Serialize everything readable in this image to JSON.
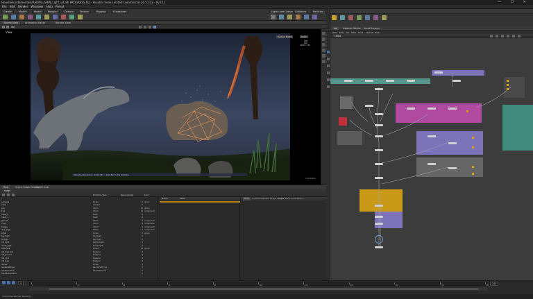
{
  "window": {
    "title": "HoudiniFundamentals/ASUMG_SHIN_Light_v4_86 PROGRESS.hip - Houdini Indie Limited Commercial 20.5.332 - Py3.11",
    "center_label": "Build",
    "controls": "— ☐ ✕"
  },
  "menubar": [
    "File",
    "Edit",
    "Render",
    "Windows",
    "Help",
    "Preset"
  ],
  "shelf": {
    "tabs": [
      "Create",
      "Modify",
      "Model",
      "Polygon",
      "Deform",
      "Texture",
      "Rigging",
      "Characters"
    ],
    "right_tabs": [
      "Lights and Cameras",
      "Collisions",
      "Particles"
    ],
    "tool_colors": [
      "#7a9a5a",
      "#5a7aa0",
      "#a07a4a",
      "#8a5a8a",
      "#5a9a9a",
      "#9a9a5a",
      "#6a6aa0",
      "#a05a5a",
      "#5aa07a",
      "#a0a05a",
      "#7a7a7a",
      "#5a8aa0"
    ]
  },
  "left_pane": {
    "tabs": [
      "Scene View",
      "Animation Editor",
      "Render View"
    ],
    "path": "obj",
    "viewport_label": "View",
    "camera_label": "Medium Detail",
    "persp_label": "cam1",
    "stats": [
      "1/61",
      "102",
      "1280 x 720"
    ],
    "status_text": "Interactive Rendering ... Karma XPU ... press Esc to stop rendering",
    "corner_label": "Indie Edition"
  },
  "spreadsheet": {
    "tabs": [
      "Tree",
      "Scene Graph Details",
      "Light Linker"
    ],
    "path": "stage",
    "columns": [
      "Primitive Type",
      "Descendants",
      "Kind"
    ],
    "rows": [
      {
        "name": "/",
        "type": "",
        "desc": "",
        "kind": ""
      },
      {
        "name": "  cameras",
        "type": "Scope",
        "desc": "2",
        "kind": "group"
      },
      {
        "name": "    cam1",
        "type": "Camera",
        "desc": "0",
        "kind": ""
      },
      {
        "name": "  geo",
        "type": "Xform",
        "desc": "41",
        "kind": "group"
      },
      {
        "name": "    trex",
        "type": "Xform",
        "desc": "12",
        "kind": "component"
      },
      {
        "name": "      mesh_0",
        "type": "Mesh",
        "desc": "0",
        "kind": ""
      },
      {
        "name": "      mesh_1",
        "type": "Mesh",
        "desc": "0",
        "kind": ""
      },
      {
        "name": "    ground",
        "type": "Xform",
        "desc": "4",
        "kind": "component"
      },
      {
        "name": "    rocks",
        "type": "Xform",
        "desc": "8",
        "kind": "component"
      },
      {
        "name": "    foliage",
        "type": "Xform",
        "desc": "9",
        "kind": "component"
      },
      {
        "name": "    lava_cage",
        "type": "Xform",
        "desc": "5",
        "kind": "component"
      },
      {
        "name": "  lights",
        "type": "Scope",
        "desc": "6",
        "kind": "group"
      },
      {
        "name": "    key_light",
        "type": "RectLight",
        "desc": "0",
        "kind": ""
      },
      {
        "name": "    fill_light",
        "type": "RectLight",
        "desc": "0",
        "kind": ""
      },
      {
        "name": "    rim_light",
        "type": "SphereLight",
        "desc": "0",
        "kind": ""
      },
      {
        "name": "    dome_light",
        "type": "DomeLight",
        "desc": "0",
        "kind": ""
      },
      {
        "name": "  materials",
        "type": "Scope",
        "desc": "14",
        "kind": "group"
      },
      {
        "name": "    mtl_trex_skin",
        "type": "Material",
        "desc": "3",
        "kind": ""
      },
      {
        "name": "    mtl_ground",
        "type": "Material",
        "desc": "3",
        "kind": ""
      },
      {
        "name": "    mtl_rock",
        "type": "Material",
        "desc": "3",
        "kind": ""
      },
      {
        "name": "    mtl_lava",
        "type": "Material",
        "desc": "3",
        "kind": ""
      },
      {
        "name": "  render",
        "type": "Scope",
        "desc": "3",
        "kind": ""
      },
      {
        "name": "    rendersettings",
        "type": "RenderSettings",
        "desc": "0",
        "kind": ""
      },
      {
        "name": "    renderproduct",
        "type": "RenderProduct",
        "desc": "0",
        "kind": ""
      },
      {
        "name": "  HoudiniLayerInfo",
        "type": "",
        "desc": "0",
        "kind": ""
      }
    ],
    "mid_header": "Name",
    "mid_header2": "Value",
    "right_tabs": [
      "Base",
      "Collections",
      "Scene Graph Layers",
      "Layer Stack",
      "Composition"
    ]
  },
  "timeline": {
    "ticks": [
      "1",
      "24",
      "48",
      "72",
      "96",
      "120",
      "144",
      "168",
      "192",
      "216",
      "240"
    ],
    "frame": "1",
    "end_frame": "240",
    "status": "Interactive Render Running..."
  },
  "network": {
    "tabs": [
      "obj",
      "Material Palette",
      "Asset Browser"
    ],
    "menu": [
      "Add",
      "Edit",
      "Go",
      "View",
      "Tools",
      "Layout",
      "Help"
    ],
    "path": "stage",
    "colors": {
      "bg": "#3c3c3c",
      "teal": "#5aa39a",
      "magenta": "#b04aa0",
      "violet": "#7d73b8",
      "gold": "#c99a17",
      "red": "#c0303a",
      "green": "#3f8a7a"
    }
  }
}
